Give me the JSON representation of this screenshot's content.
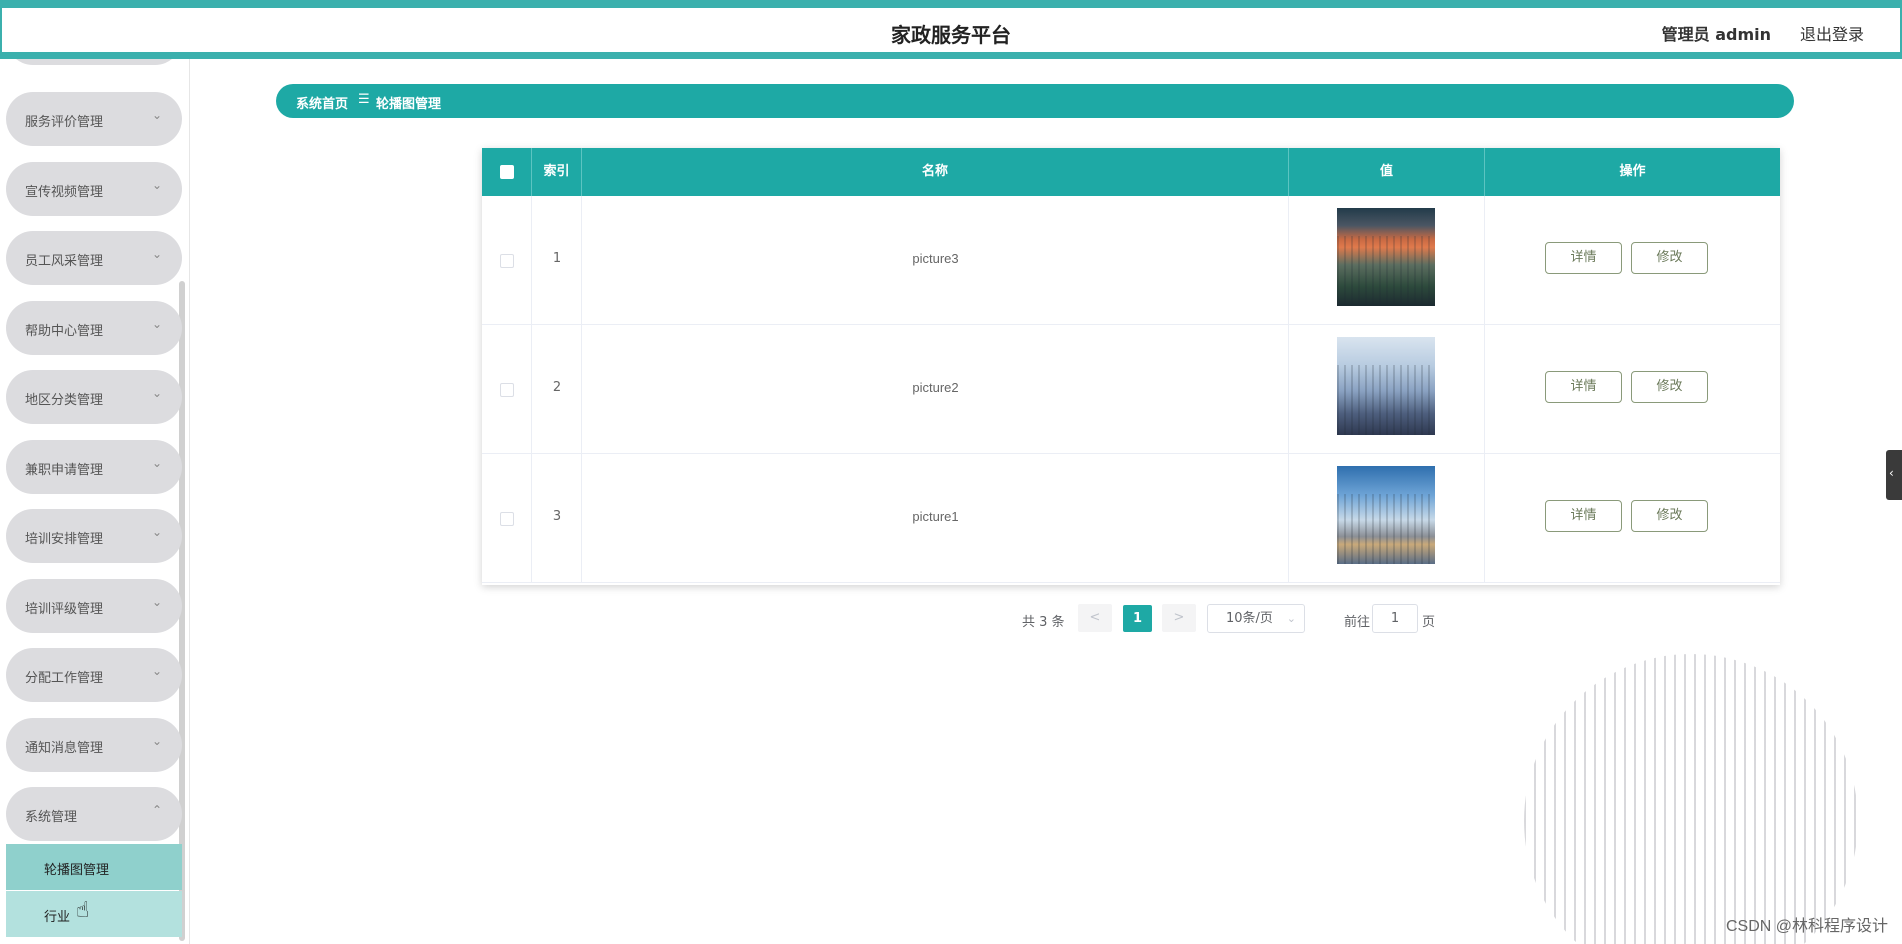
{
  "header": {
    "title": "家政服务平台",
    "user": "管理员 admin",
    "logout": "退出登录"
  },
  "sidebar": {
    "items": [
      {
        "label": "服务评价管理",
        "chevron": "⌄"
      },
      {
        "label": "宣传视频管理",
        "chevron": "⌄"
      },
      {
        "label": "员工风采管理",
        "chevron": "⌄"
      },
      {
        "label": "帮助中心管理",
        "chevron": "⌄"
      },
      {
        "label": "地区分类管理",
        "chevron": "⌄"
      },
      {
        "label": "兼职申请管理",
        "chevron": "⌄"
      },
      {
        "label": "培训安排管理",
        "chevron": "⌄"
      },
      {
        "label": "培训评级管理",
        "chevron": "⌄"
      },
      {
        "label": "分配工作管理",
        "chevron": "⌄"
      },
      {
        "label": "通知消息管理",
        "chevron": "⌄"
      },
      {
        "label": "系统管理",
        "chevron": "⌃"
      }
    ],
    "submenu": [
      {
        "label": "轮播图管理"
      },
      {
        "label": "行业"
      }
    ]
  },
  "breadcrumb": {
    "home": "系统首页",
    "separator": "☰",
    "current": "轮播图管理"
  },
  "table": {
    "headers": {
      "index": "索引",
      "name": "名称",
      "value": "值",
      "actions": "操作"
    },
    "rows": [
      {
        "index": "1",
        "name": "picture3",
        "image": "p3",
        "detail": "详情",
        "edit": "修改"
      },
      {
        "index": "2",
        "name": "picture2",
        "image": "p2",
        "detail": "详情",
        "edit": "修改"
      },
      {
        "index": "3",
        "name": "picture1",
        "image": "p1",
        "detail": "详情",
        "edit": "修改"
      }
    ]
  },
  "pagination": {
    "total": "共 3 条",
    "prev": "<",
    "current_page": "1",
    "next": ">",
    "page_size": "10条/页",
    "goto_label": "前往",
    "goto_value": "1",
    "goto_unit": "页"
  },
  "side_tab": {
    "icon": "‹"
  },
  "watermark": "CSDN @林科程序设计",
  "colors": {
    "accent": "#1ea9a5",
    "header_stripe": "#3bb0ad",
    "menu_bg": "#dcdcdf",
    "submenu_active": "#8fd0cc"
  }
}
